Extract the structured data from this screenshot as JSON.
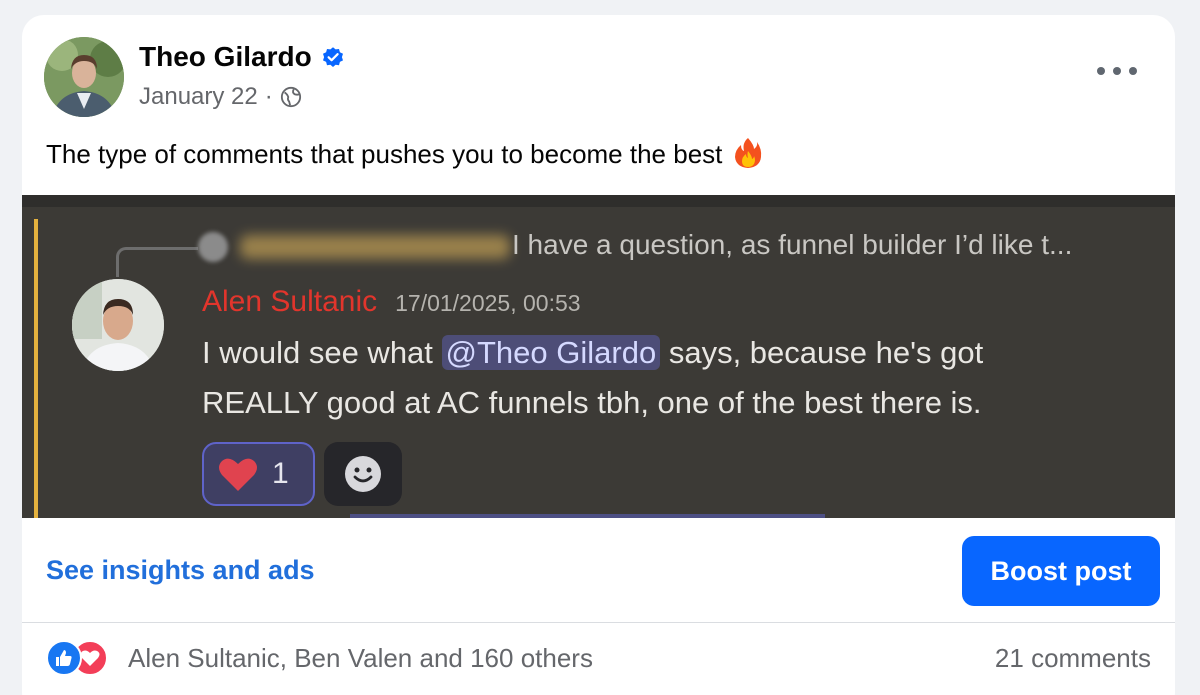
{
  "post": {
    "author_name": "Theo Gilardo",
    "date": "January 22",
    "separator": "·",
    "privacy_icon": "globe-icon",
    "more_icon": "more-options-icon",
    "text": "The type of comments that pushes you to become the best",
    "emoji_icon": "fire-emoji"
  },
  "screenshot": {
    "reply_preview": "I have a question, as funnel builder I’d like t...",
    "commenter_name": "Alen Sultanic",
    "timestamp": "17/01/2025, 00:53",
    "line1_before": "I would see what ",
    "mention": "@Theo Gilardo",
    "line1_after": " says, because he's got",
    "line2": "REALLY good at AC funnels tbh, one of the best there is.",
    "reaction_count": "1"
  },
  "actions": {
    "insights_label": "See insights and ads",
    "boost_label": "Boost post"
  },
  "engagement": {
    "reactors": "Alen Sultanic, Ben Valen and 160 others",
    "comments": "21 comments"
  },
  "colors": {
    "accent": "#0866ff",
    "link": "#216fdb",
    "commenter_name": "#e2352c",
    "mention_bg": "#4d4d77"
  }
}
